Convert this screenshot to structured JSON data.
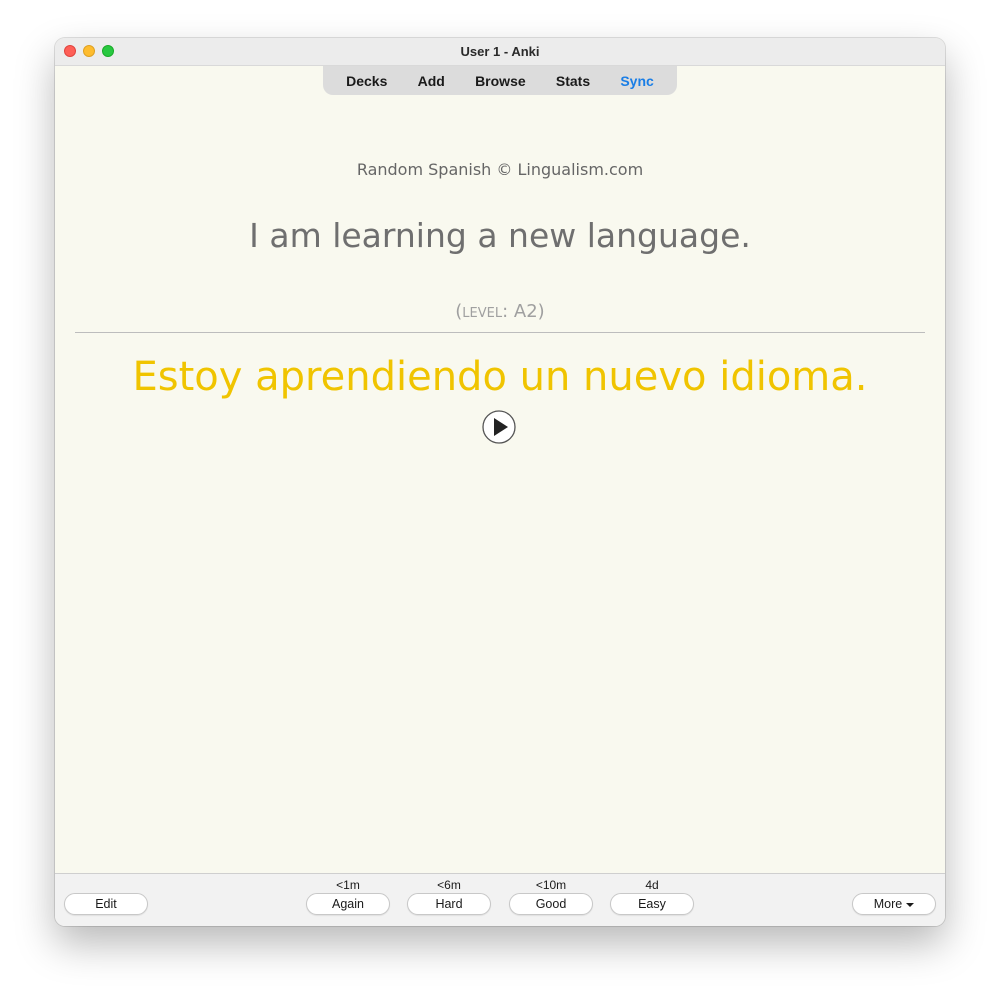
{
  "window": {
    "title": "User 1 - Anki"
  },
  "toolbar": {
    "items": [
      {
        "label": "Decks"
      },
      {
        "label": "Add"
      },
      {
        "label": "Browse"
      },
      {
        "label": "Stats"
      },
      {
        "label": "Sync"
      }
    ],
    "active_color": "#1a7ee6"
  },
  "card": {
    "credit": "Random Spanish © Lingualism.com",
    "front": "I am learning a new language.",
    "level_prefix": "(level: ",
    "level_value": "A2",
    "level_suffix": ")",
    "back": "Estoy aprendiendo un nuevo idioma.",
    "back_color": "#f0c400",
    "play_icon": "play-circle-icon"
  },
  "bottom": {
    "edit_label": "Edit",
    "more_label": "More",
    "answers": [
      {
        "interval": "<1m",
        "label": "Again"
      },
      {
        "interval": "<6m",
        "label": "Hard"
      },
      {
        "interval": "<10m",
        "label": "Good"
      },
      {
        "interval": "4d",
        "label": "Easy"
      }
    ]
  }
}
